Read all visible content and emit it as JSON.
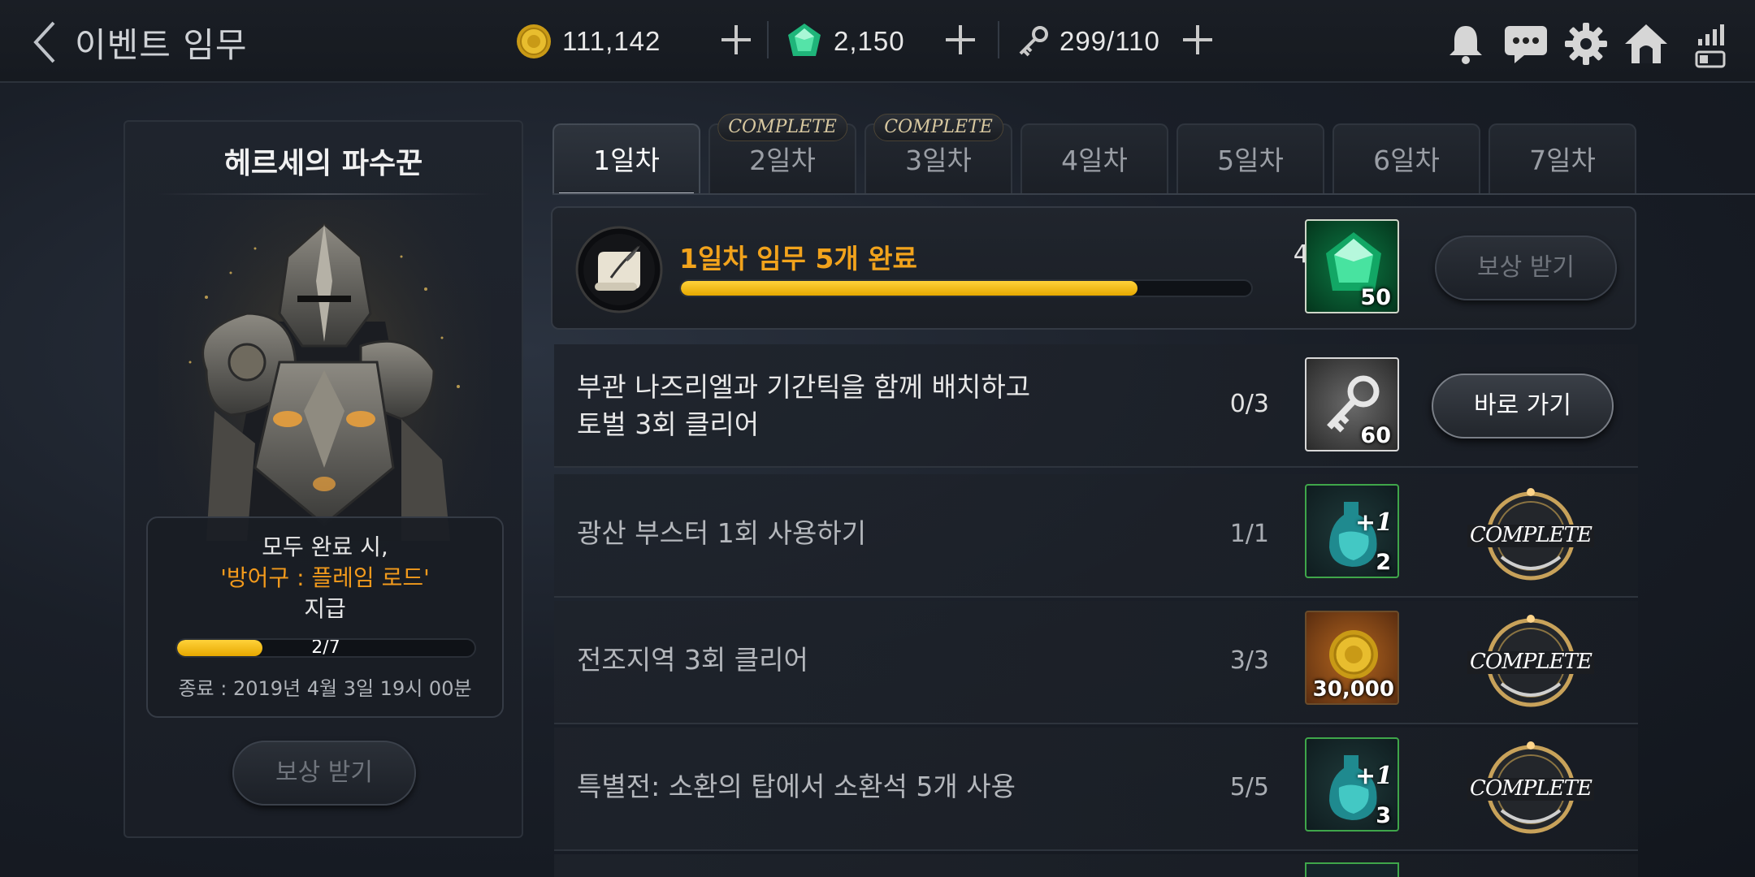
{
  "header": {
    "title": "이벤트 임무",
    "gold": "111,142",
    "gems": "2,150",
    "keys": "299/110"
  },
  "panel": {
    "title": "헤르세의 파수꾼",
    "reward_line1": "모두 완료 시,",
    "reward_line2": "'방어구 : 플레임 로드'",
    "reward_line3": "지급",
    "progress_text": "2/7",
    "progress_fraction": 0.2857,
    "end_time": "종료 : 2019년 4월 3일 19시 00분",
    "claim_label": "보상 받기"
  },
  "tabs": [
    {
      "label": "1일차",
      "badge": ""
    },
    {
      "label": "2일차",
      "badge": "COMPLETE"
    },
    {
      "label": "3일차",
      "badge": "COMPLETE"
    },
    {
      "label": "4일차",
      "badge": ""
    },
    {
      "label": "5일차",
      "badge": ""
    },
    {
      "label": "6일차",
      "badge": ""
    },
    {
      "label": "7일차",
      "badge": ""
    }
  ],
  "main_task": {
    "title": "1일차 임무 5개 완료",
    "progress_text": "4/5",
    "progress_fraction": 0.8,
    "reward_qty": "50",
    "reward_icon": "green-gem-icon",
    "button_label": "보상 받기"
  },
  "tasks": [
    {
      "line1": "부관 나즈리엘과 기간틱을 함께 배치하고",
      "line2": "토벌 3회 클리어",
      "progress": "0/3",
      "reward_qty": "60",
      "reward_icon": "key-icon",
      "button_label": "바로 가기",
      "status": "active"
    },
    {
      "line1": "광산 부스터 1회 사용하기",
      "line2": "",
      "progress": "1/1",
      "reward_qty": "2",
      "reward_badge": "+1",
      "reward_icon": "booster-potion-icon",
      "stamp": "COMPLETE",
      "status": "done"
    },
    {
      "line1": "전조지역 3회 클리어",
      "line2": "",
      "progress": "3/3",
      "reward_qty": "30,000",
      "reward_icon": "gold-coin-icon",
      "stamp": "COMPLETE",
      "status": "done"
    },
    {
      "line1": "특별전: 소환의 탑에서 소환석 5개 사용",
      "line2": "",
      "progress": "5/5",
      "reward_qty": "3",
      "reward_badge": "+1",
      "reward_icon": "booster-potion-icon",
      "stamp": "COMPLETE",
      "status": "done"
    }
  ],
  "colors": {
    "accent_orange": "#f2a31c",
    "progress_yellow": "#ffd23a",
    "complete_gold": "#c8a25a"
  }
}
